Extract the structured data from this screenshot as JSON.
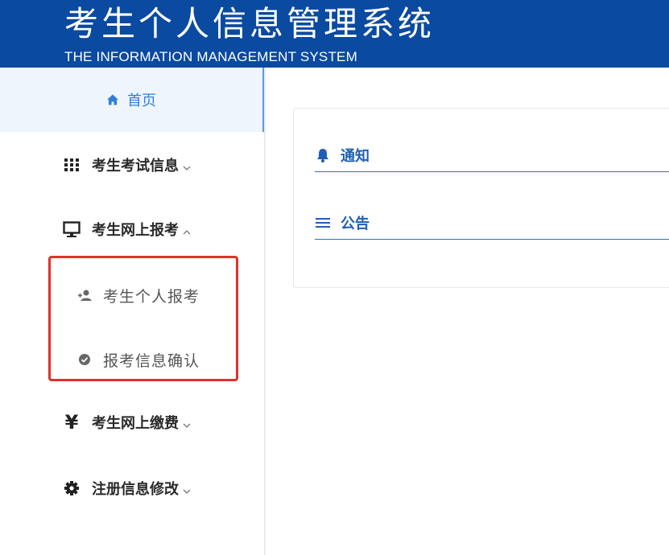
{
  "header": {
    "title": "考生个人信息管理系统",
    "subtitle": "THE INFORMATION MANAGEMENT SYSTEM"
  },
  "sidebar": {
    "home": {
      "label": "首页",
      "icon": "home-icon"
    },
    "items": [
      {
        "label": "考生考试信息",
        "icon": "grid-icon",
        "expanded": false
      },
      {
        "label": "考生网上报考",
        "icon": "monitor-icon",
        "expanded": true,
        "children": [
          {
            "label": "考生个人报考",
            "icon": "user-add-icon"
          },
          {
            "label": "报考信息确认",
            "icon": "check-circle-icon"
          }
        ]
      },
      {
        "label": "考生网上缴费",
        "icon": "yen-icon",
        "expanded": false
      },
      {
        "label": "注册信息修改",
        "icon": "gear-icon",
        "expanded": false
      }
    ]
  },
  "main": {
    "rows": [
      {
        "label": "通知",
        "icon": "bell-icon"
      },
      {
        "label": "公告",
        "icon": "menu-lines-icon"
      }
    ]
  },
  "colors": {
    "header_bg": "#0a4aa0",
    "accent": "#2f7fd6",
    "highlight_border": "#e0312c"
  }
}
